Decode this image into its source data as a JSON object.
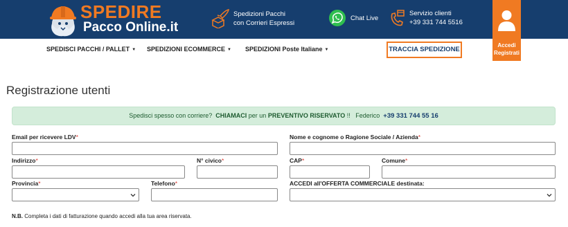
{
  "brand": {
    "name_line1": "SPEDIRE",
    "name_line2": "Pacco Online.it",
    "colors": {
      "navy": "#163e6e",
      "orange": "#f07a22"
    }
  },
  "header": {
    "info1": {
      "icon": "parcel-rocket-icon",
      "line1": "Spedizioni Pacchi",
      "line2": "con Corrieri Espressi"
    },
    "info2": {
      "icon": "whatsapp-icon",
      "label": "Chat Live"
    },
    "info3": {
      "icon": "phone-parcel-icon",
      "line1": "Servizio clienti",
      "line2": "+39 331 744 5516"
    },
    "login": {
      "icon": "user-icon",
      "line1": "Accedi",
      "line2": "Registrati"
    }
  },
  "nav": {
    "items": [
      {
        "label": "SPEDISCI PACCHI / PALLET"
      },
      {
        "label": "SPEDIZIONI ECOMMERCE"
      },
      {
        "label": "SPEDIZIONI Poste Italiane"
      }
    ],
    "caret": "▼",
    "track_label": "TRACCIA SPEDIZIONE"
  },
  "page": {
    "title": "Registrazione utenti",
    "alert": {
      "part1": "Spedisci spesso con corriere?",
      "part2": "CHIAMACI",
      "part3": "per un",
      "part4": "PREVENTIVO RISERVATO",
      "part5": "!!",
      "part6": "Federico",
      "phone": "+39 331 744 55 16"
    },
    "req_mark": "*",
    "fields": {
      "email": {
        "label": "Email per ricevere LDV",
        "value": ""
      },
      "nome": {
        "label": "Nome e cognome o Ragione Sociale / Azienda",
        "value": ""
      },
      "indirizzo": {
        "label": "Indirizzo",
        "value": ""
      },
      "civico": {
        "label": "N° civico",
        "value": ""
      },
      "cap": {
        "label": "CAP",
        "value": ""
      },
      "comune": {
        "label": "Comune",
        "value": ""
      },
      "provincia": {
        "label": "Provincia",
        "value": ""
      },
      "telefono": {
        "label": "Telefono",
        "value": ""
      },
      "offerta": {
        "label": "ACCEDI all'OFFERTA COMMERCIALE destinata:",
        "value": ""
      }
    },
    "note": {
      "bold": "N.B.",
      "text": "Completa i dati di fatturazione quando accedi alla tua area riservata."
    }
  }
}
